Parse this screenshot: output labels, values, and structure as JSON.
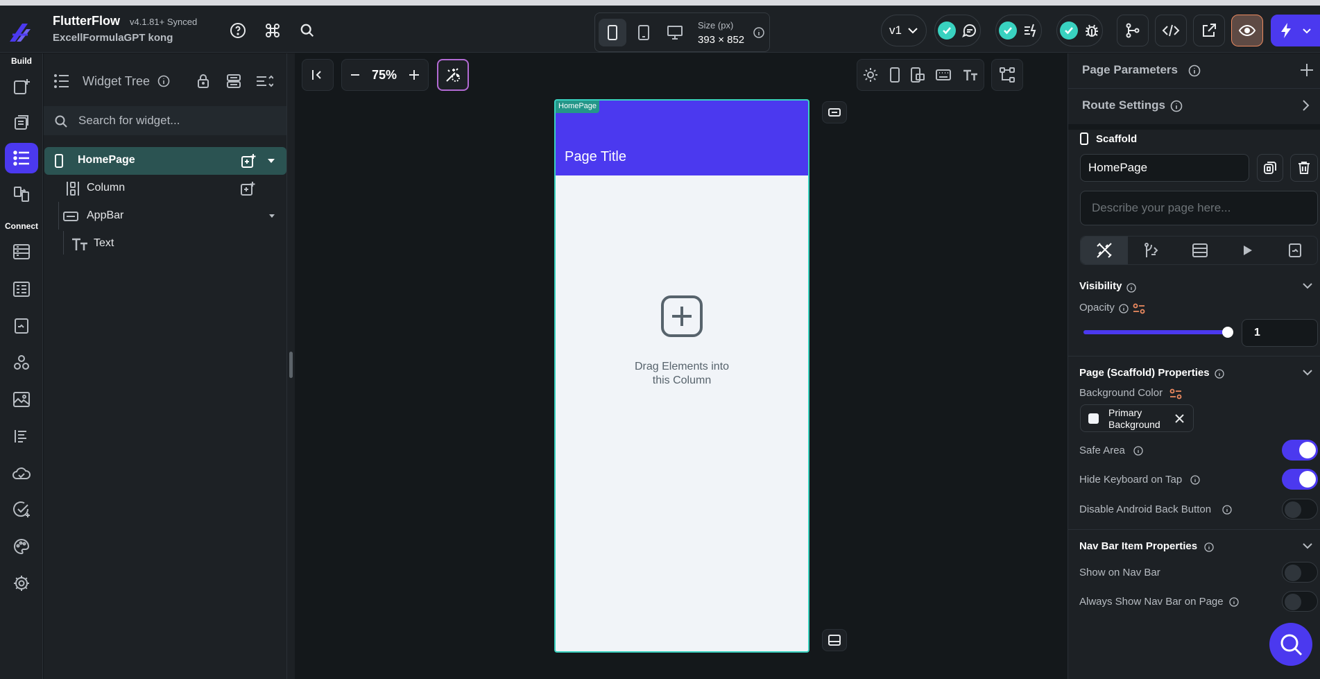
{
  "app": {
    "name": "FlutterFlow",
    "version": "v4.1.81+ Synced",
    "project": "ExcellFormulaGPT kong"
  },
  "device": {
    "size_label": "Size (px)",
    "size_value": "393 × 852"
  },
  "version_select": {
    "value": "v1"
  },
  "nav": {
    "build_label": "Build",
    "connect_label": "Connect"
  },
  "tree": {
    "title": "Widget Tree",
    "search_placeholder": "Search for widget...",
    "rows": [
      {
        "label": "HomePage"
      },
      {
        "label": "Column"
      },
      {
        "label": "AppBar"
      },
      {
        "label": "Text"
      }
    ]
  },
  "canvas": {
    "zoom": "75%",
    "page_tag": "HomePage",
    "page_title": "Page Title",
    "drop_text_1": "Drag Elements into",
    "drop_text_2": "this Column"
  },
  "props": {
    "page_parameters": "Page Parameters",
    "route_settings": "Route Settings",
    "scaffold_label": "Scaffold",
    "page_name": "HomePage",
    "describe_placeholder": "Describe your page here...",
    "visibility": "Visibility",
    "opacity_label": "Opacity",
    "opacity_value": "1",
    "opacity_fraction": 1.0,
    "scaffold_props": "Page (Scaffold) Properties",
    "bg_color_label": "Background Color",
    "bg_color_value_1": "Primary",
    "bg_color_value_2": "Background",
    "safe_area": "Safe Area",
    "hide_keyboard": "Hide Keyboard on Tap",
    "disable_back": "Disable Android Back Button",
    "nav_bar_props": "Nav Bar Item Properties",
    "show_nav": "Show on Nav Bar",
    "always_show_nav": "Always Show Nav Bar on Page"
  },
  "toggles": {
    "safe_area": true,
    "hide_keyboard": true,
    "disable_back": false,
    "show_nav": false,
    "always_show_nav": false
  },
  "colors": {
    "primary": "#4b39ef",
    "tertiary": "#39d2c0",
    "selected_row": "#2b5352",
    "panel": "#1d2125",
    "canvas_bg": "#14181b",
    "accent_orange": "#ee8b60"
  }
}
